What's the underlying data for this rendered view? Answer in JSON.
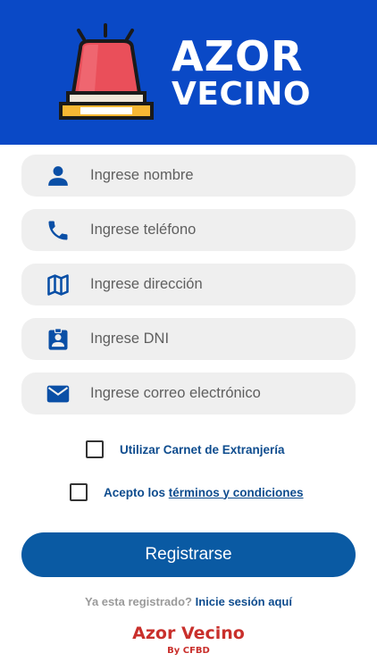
{
  "header": {
    "brand_line1": "AZOR",
    "brand_line2": "VECINO",
    "logo_icon": "siren-icon",
    "background_color": "#0a49c6"
  },
  "form": {
    "fields": [
      {
        "icon": "person-icon",
        "placeholder": "Ingrese nombre",
        "value": ""
      },
      {
        "icon": "phone-icon",
        "placeholder": "Ingrese teléfono",
        "value": ""
      },
      {
        "icon": "map-icon",
        "placeholder": "Ingrese dirección",
        "value": ""
      },
      {
        "icon": "id-badge-icon",
        "placeholder": "Ingrese DNI",
        "value": ""
      },
      {
        "icon": "email-icon",
        "placeholder": "Ingrese correo electrónico",
        "value": ""
      }
    ],
    "foreign_card_label": "Utilizar Carnet de Extranjería",
    "foreign_card_checked": false,
    "terms_prefix": "Acepto los",
    "terms_link": "términos y condiciones",
    "terms_checked": false
  },
  "register_button": {
    "label": "Registrarse",
    "color": "#0a5aa3"
  },
  "login_prompt": {
    "question": "Ya esta registrado?",
    "link": "Inicie sesión aquí"
  },
  "footer": {
    "title": "Azor Vecino",
    "subtitle": "By CFBD",
    "color": "#c9302c"
  },
  "accent_color": "#0e4c8e"
}
